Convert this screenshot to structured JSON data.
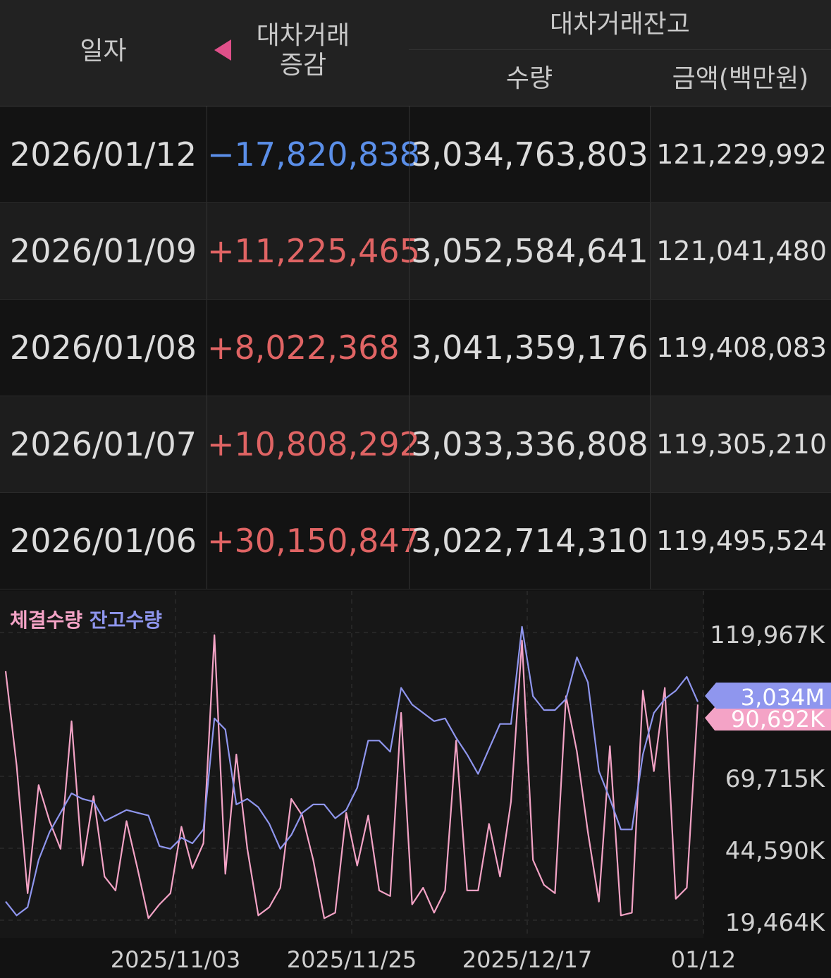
{
  "table": {
    "headers": {
      "date": "일자",
      "change_line1": "대차거래",
      "change_line2": "증감",
      "balance": "대차거래잔고",
      "quantity": "수량",
      "amount": "금액(백만원)"
    },
    "rows": [
      {
        "date": "2026/01/12",
        "change": "−17,820,838",
        "change_dir": "down",
        "quantity": "3,034,763,803",
        "amount": "121,229,992"
      },
      {
        "date": "2026/01/09",
        "change": "+11,225,465",
        "change_dir": "up",
        "quantity": "3,052,584,641",
        "amount": "121,041,480"
      },
      {
        "date": "2026/01/08",
        "change": "+8,022,368",
        "change_dir": "up",
        "quantity": "3,041,359,176",
        "amount": "119,408,083"
      },
      {
        "date": "2026/01/07",
        "change": "+10,808,292",
        "change_dir": "up",
        "quantity": "3,033,336,808",
        "amount": "119,305,210"
      },
      {
        "date": "2026/01/06",
        "change": "+30,150,847",
        "change_dir": "up",
        "quantity": "3,022,714,310",
        "amount": "119,495,524"
      }
    ]
  },
  "colors": {
    "up": "#e06464",
    "down": "#5b8fe9",
    "executed_series": "#f4a3c6",
    "balance_series": "#8f96ee",
    "sort_arrow": "#e0508a"
  },
  "chart_data": {
    "type": "line",
    "legend": [
      "체결수량",
      "잔고수량"
    ],
    "x_ticks": [
      "2025/11/03",
      "2025/11/25",
      "2025/12/17",
      "01/12"
    ],
    "y_ticks": [
      "119,967K",
      "69,715K",
      "44,590K",
      "19,464K"
    ],
    "ylim": [
      17000,
      127000
    ],
    "markers": {
      "balance": "3,034M",
      "executed": "90,692K"
    },
    "series": [
      {
        "name": "체결수량",
        "values": [
          110000,
          76000,
          30000,
          69000,
          56000,
          46000,
          92000,
          40000,
          65000,
          36000,
          31000,
          56000,
          39000,
          21000,
          26000,
          30000,
          54000,
          39000,
          48000,
          123000,
          37000,
          80000,
          46000,
          22000,
          25000,
          32000,
          64000,
          58000,
          42000,
          21000,
          23000,
          59000,
          40000,
          58000,
          31000,
          29000,
          95000,
          26000,
          32000,
          23000,
          31000,
          85000,
          31000,
          31000,
          55000,
          36000,
          63000,
          121000,
          42000,
          33000,
          30000,
          101000,
          81000,
          52000,
          27000,
          83000,
          22000,
          23000,
          103000,
          74000,
          104000,
          28000,
          32000,
          98000
        ],
        "balance_equiv": false
      },
      {
        "name": "잔고수량",
        "values": [
          27000,
          22000,
          25000,
          42000,
          52000,
          59000,
          66000,
          64000,
          63000,
          56000,
          58000,
          60000,
          59000,
          58000,
          47000,
          46000,
          50000,
          48000,
          53000,
          93000,
          89000,
          62000,
          64000,
          61000,
          55000,
          46000,
          51000,
          59000,
          62000,
          62000,
          57000,
          60000,
          68000,
          85000,
          85000,
          81000,
          104000,
          98000,
          95000,
          92000,
          93000,
          86000,
          80000,
          73000,
          82000,
          91000,
          91000,
          126000,
          101000,
          96000,
          96000,
          100000,
          115000,
          106000,
          74000,
          64000,
          53000,
          53000,
          80000,
          95000,
          100000,
          103000,
          108000,
          99000
        ]
      }
    ]
  }
}
